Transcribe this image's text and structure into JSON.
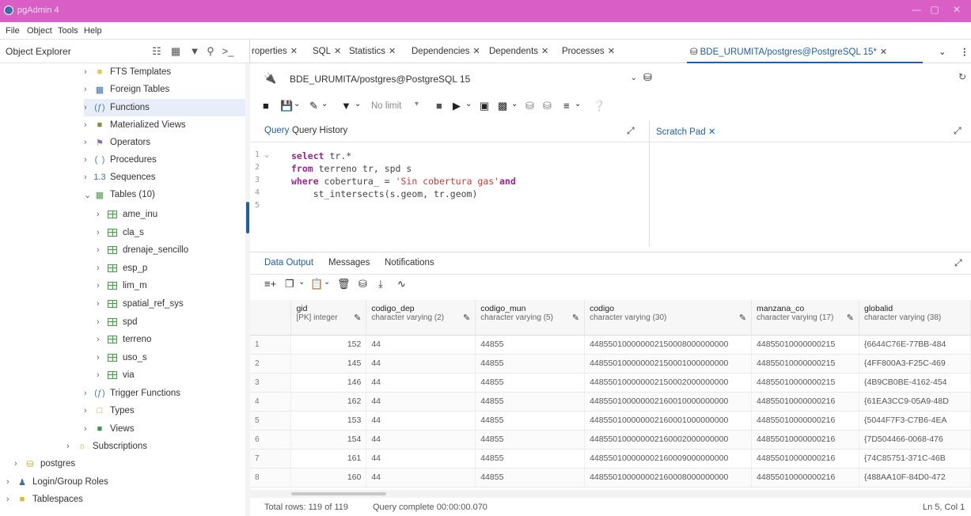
{
  "window": {
    "title": "pgAdmin 4",
    "controls": [
      "—",
      "▢",
      "✕"
    ]
  },
  "menu": [
    "File",
    "Object",
    "Tools",
    "Help"
  ],
  "object_explorer": {
    "title": "Object Explorer",
    "tree": [
      {
        "label": "FTS Templates",
        "icon": "fts-template-icon",
        "depth": 1
      },
      {
        "label": "Foreign Tables",
        "icon": "foreign-table-icon",
        "depth": 1
      },
      {
        "label": "Functions",
        "icon": "function-icon",
        "depth": 1
      },
      {
        "label": "Materialized Views",
        "icon": "materialized-view-icon",
        "depth": 1
      },
      {
        "label": "Operators",
        "icon": "operator-icon",
        "depth": 1
      },
      {
        "label": "Procedures",
        "icon": "procedure-icon",
        "depth": 1
      },
      {
        "label": "Sequences",
        "icon": "sequence-icon",
        "depth": 1
      },
      {
        "label": "Tables (10)",
        "icon": "tables-icon",
        "depth": 1,
        "expanded": true
      },
      {
        "label": "ame_inu",
        "icon": "table-icon",
        "depth": 2
      },
      {
        "label": "cla_s",
        "icon": "table-icon",
        "depth": 2
      },
      {
        "label": "drenaje_sencillo",
        "icon": "table-icon",
        "depth": 2
      },
      {
        "label": "esp_p",
        "icon": "table-icon",
        "depth": 2
      },
      {
        "label": "lim_m",
        "icon": "table-icon",
        "depth": 2
      },
      {
        "label": "spatial_ref_sys",
        "icon": "table-icon",
        "depth": 2
      },
      {
        "label": "spd",
        "icon": "table-icon",
        "depth": 2
      },
      {
        "label": "terreno",
        "icon": "table-icon",
        "depth": 2
      },
      {
        "label": "uso_s",
        "icon": "table-icon",
        "depth": 2
      },
      {
        "label": "via",
        "icon": "table-icon",
        "depth": 2
      },
      {
        "label": "Trigger Functions",
        "icon": "trigger-function-icon",
        "depth": 1
      },
      {
        "label": "Types",
        "icon": "type-icon",
        "depth": 1
      },
      {
        "label": "Views",
        "icon": "view-icon",
        "depth": 1
      },
      {
        "label": "Subscriptions",
        "icon": "subscription-icon",
        "depth": 0
      },
      {
        "label": "postgres",
        "icon": "database-icon",
        "depth": -1
      },
      {
        "label": "Login/Group Roles",
        "icon": "roles-icon",
        "depth": -2
      },
      {
        "label": "Tablespaces",
        "icon": "tablespace-icon",
        "depth": -2
      }
    ]
  },
  "tabs": [
    {
      "label": "roperties"
    },
    {
      "label": "SQL"
    },
    {
      "label": "Statistics"
    },
    {
      "label": "Dependencies"
    },
    {
      "label": "Dependents"
    },
    {
      "label": "Processes"
    },
    {
      "label": "BDE_URUMITA/postgres@PostgreSQL 15*",
      "active": true
    }
  ],
  "connection": {
    "value": "BDE_URUMITA/postgres@PostgreSQL 15"
  },
  "toolbar": {
    "limit_label": "No limit"
  },
  "query_pane": {
    "tabs": [
      "Query",
      "Query History"
    ],
    "lines": [
      {
        "n": "1",
        "html": "<span class='kw'>select</span> tr.*"
      },
      {
        "n": "2",
        "html": "<span class='kw'>from</span> terreno tr, spd s"
      },
      {
        "n": "3",
        "html": "<span class='kw'>where</span> cobertura_ = <span class='str'>'Sin cobertura gas'</span><span class='kw'>and</span>"
      },
      {
        "n": "4",
        "html": "    st_intersects(s.geom, tr.geom)"
      },
      {
        "n": "5",
        "html": ""
      }
    ]
  },
  "scratch_pad": {
    "title": "Scratch Pad"
  },
  "results": {
    "tabs": [
      "Data Output",
      "Messages",
      "Notifications"
    ],
    "columns": [
      {
        "name": "gid",
        "type": "[PK] integer"
      },
      {
        "name": "codigo_dep",
        "type": "character varying (2)"
      },
      {
        "name": "codigo_mun",
        "type": "character varying (5)"
      },
      {
        "name": "codigo",
        "type": "character varying (30)"
      },
      {
        "name": "manzana_co",
        "type": "character varying (17)"
      },
      {
        "name": "globalid",
        "type": "character varying (38)"
      }
    ],
    "rows": [
      [
        "1",
        "152",
        "44",
        "44855",
        "448550100000002150008000000000",
        "44855010000000215",
        "{6644C76E-77BB-484"
      ],
      [
        "2",
        "145",
        "44",
        "44855",
        "448550100000002150001000000000",
        "44855010000000215",
        "{4FF800A3-F25C-469"
      ],
      [
        "3",
        "146",
        "44",
        "44855",
        "448550100000002150002000000000",
        "44855010000000215",
        "{4B9CB0BE-4162-454"
      ],
      [
        "4",
        "162",
        "44",
        "44855",
        "448550100000002160010000000000",
        "44855010000000216",
        "{61EA3CC9-05A9-48D"
      ],
      [
        "5",
        "153",
        "44",
        "44855",
        "448550100000002160001000000000",
        "44855010000000216",
        "{5044F7F3-C7B6-4EA"
      ],
      [
        "6",
        "154",
        "44",
        "44855",
        "448550100000002160002000000000",
        "44855010000000216",
        "{7D504466-0068-476"
      ],
      [
        "7",
        "161",
        "44",
        "44855",
        "448550100000002160009000000000",
        "44855010000000216",
        "{74C85751-371C-46B"
      ],
      [
        "8",
        "160",
        "44",
        "44855",
        "448550100000002160008000000000",
        "44855010000000216",
        "{488AA10F-84D0-472"
      ]
    ],
    "status": {
      "total_rows": "Total rows: 119 of 119",
      "query_time": "Query complete 00:00:00.070",
      "cursor": "Ln 5, Col 1"
    }
  },
  "colors": {
    "titlebar": "#d95fc6",
    "accent": "#1d5fa8"
  }
}
